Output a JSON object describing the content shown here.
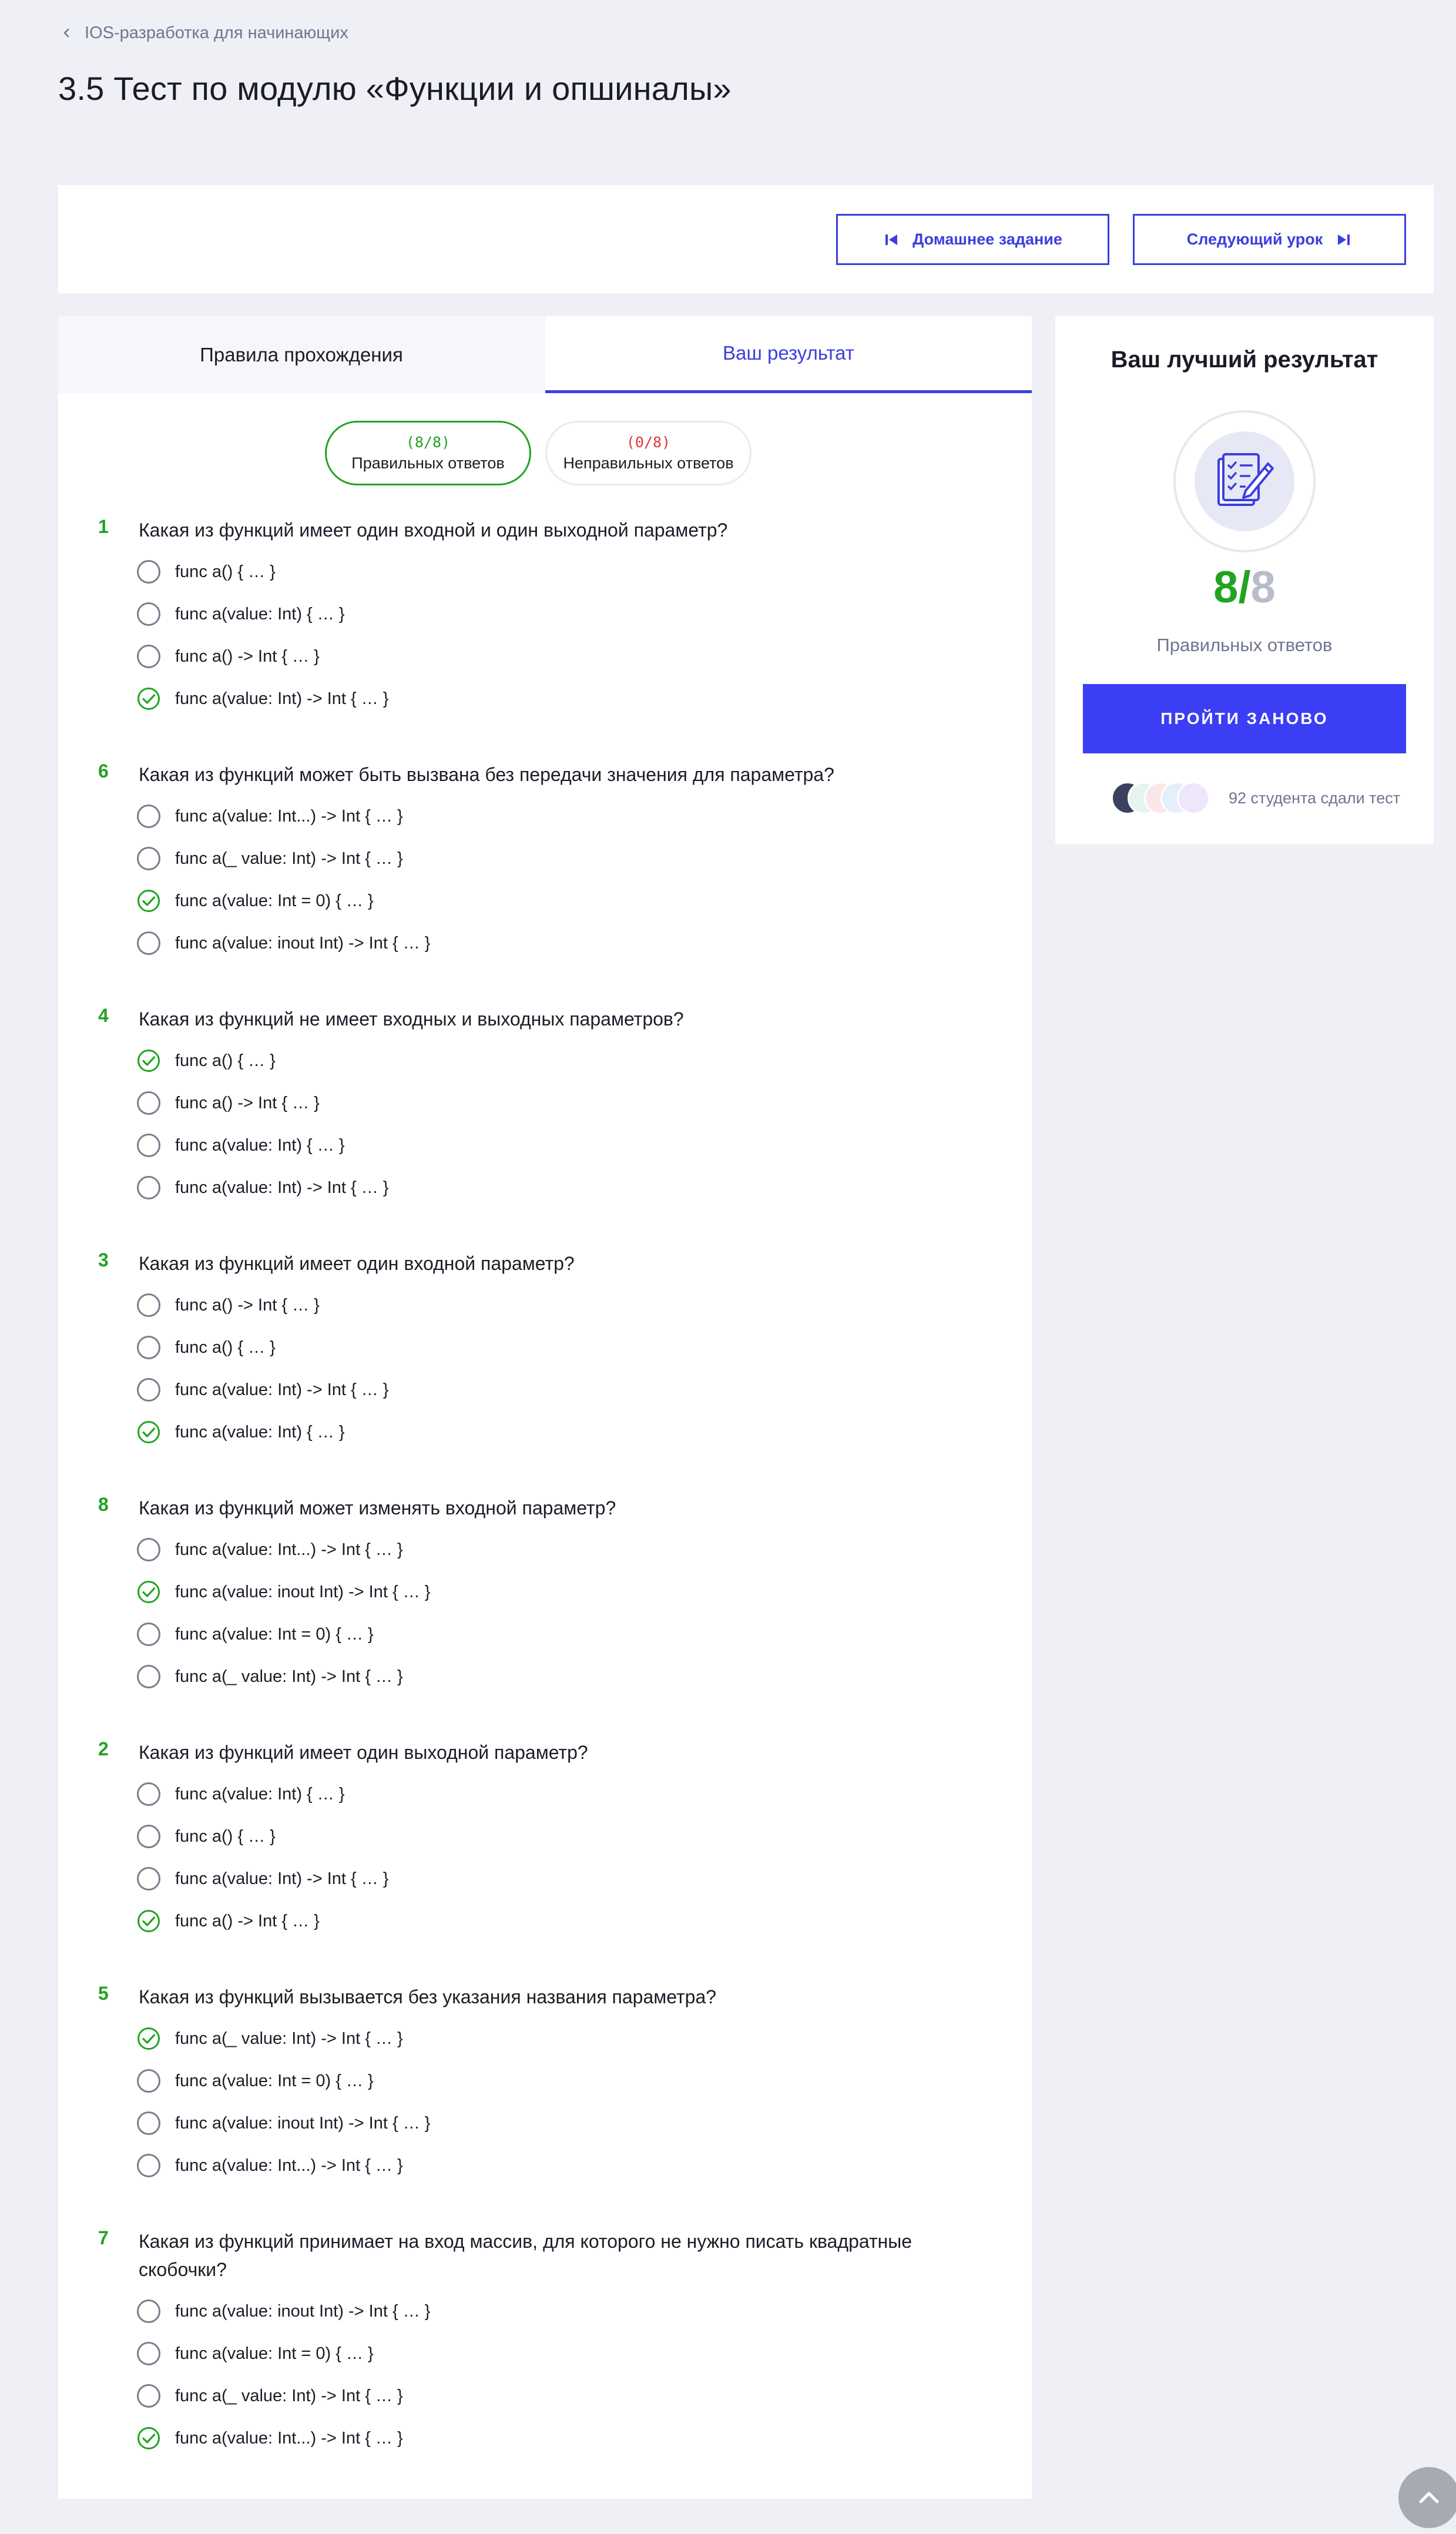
{
  "breadcrumb": {
    "back_label": "IOS-разработка для начинающих"
  },
  "page": {
    "title": "3.5 Тест по модулю «Функции и опшиналы»"
  },
  "actions": {
    "homework": "Домашнее задание",
    "next_lesson": "Следующий урок"
  },
  "tabs": {
    "rules": "Правила прохождения",
    "result": "Ваш результат",
    "active": "result"
  },
  "summary": {
    "correct_count": "(8/8)",
    "correct_label": "Правильных ответов",
    "wrong_count": "(0/8)",
    "wrong_label": "Неправильных ответов"
  },
  "questions": [
    {
      "num": "1",
      "text": "Какая из функций имеет один входной и один выходной параметр?",
      "options": [
        "func a() { … }",
        "func a(value: Int) { … }",
        "func a() -> Int { … }",
        "func a(value: Int) -> Int { … }"
      ],
      "correct": 3
    },
    {
      "num": "6",
      "text": "Какая из функций может быть вызвана без передачи значения для параметра?",
      "options": [
        "func a(value: Int...) -> Int { … }",
        "func a(_ value: Int) -> Int { … }",
        "func a(value: Int = 0) { … }",
        "func a(value: inout Int) -> Int { … }"
      ],
      "correct": 2
    },
    {
      "num": "4",
      "text": "Какая из функций не имеет входных и выходных параметров?",
      "options": [
        "func a() { … }",
        "func a() -> Int { … }",
        "func a(value: Int) { … }",
        "func a(value: Int) -> Int { … }"
      ],
      "correct": 0
    },
    {
      "num": "3",
      "text": "Какая из функций имеет один входной параметр?",
      "options": [
        "func a() -> Int { … }",
        "func a() { … }",
        "func a(value: Int) -> Int { … }",
        "func a(value: Int) { … }"
      ],
      "correct": 3
    },
    {
      "num": "8",
      "text": "Какая из функций может изменять входной параметр?",
      "options": [
        "func a(value: Int...) -> Int { … }",
        "func a(value: inout Int) -> Int { … }",
        "func a(value: Int = 0) { … }",
        "func a(_ value: Int) -> Int { … }"
      ],
      "correct": 1
    },
    {
      "num": "2",
      "text": "Какая из функций имеет один выходной параметр?",
      "options": [
        "func a(value: Int) { … }",
        "func a() { … }",
        "func a(value: Int) -> Int { … }",
        "func a() -> Int { … }"
      ],
      "correct": 3
    },
    {
      "num": "5",
      "text": "Какая из функций вызывается без указания названия параметра?",
      "options": [
        "func a(_ value: Int) -> Int { … }",
        "func a(value: Int = 0) { … }",
        "func a(value: inout Int) -> Int { … }",
        "func a(value: Int...) -> Int { … }"
      ],
      "correct": 0
    },
    {
      "num": "7",
      "text": "Какая из функций принимает на вход массив, для которого не нужно писать квадратные скобочки?",
      "options": [
        "func a(value: inout Int) -> Int { … }",
        "func a(value: Int = 0) { … }",
        "func a(_ value: Int) -> Int { … }",
        "func a(value: Int...) -> Int { … }"
      ],
      "correct": 3
    }
  ],
  "best": {
    "title": "Ваш лучший результат",
    "score_got": "8",
    "score_sep": "/",
    "score_total": "8",
    "score_label": "Правильных ответов",
    "retry": "ПРОЙТИ ЗАНОВО",
    "students_text": "92 студента сдали тест"
  },
  "colors": {
    "accent": "#3b3ef5",
    "correct": "#22a322",
    "wrong": "#e0343d"
  }
}
